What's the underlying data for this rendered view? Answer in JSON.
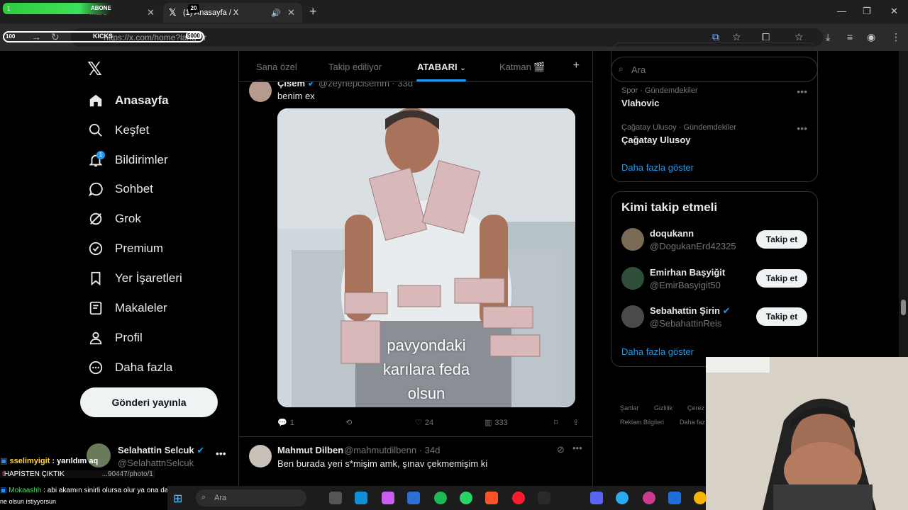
{
  "browser": {
    "tab1_title": "...ard",
    "tab2_title": "(1) Anasayfa / X",
    "url": "https://x.com/home?lang=tr",
    "overlay_abone": "ABONE",
    "overlay_abone_count": "20",
    "overlay_abone_one": "1",
    "overlay_kicks": "KICKS",
    "overlay_kicks_min": "100",
    "overlay_kicks_max": "5000"
  },
  "nav": {
    "logo": "𝕏",
    "items": [
      {
        "label": "Anasayfa",
        "icon": "home-icon",
        "active": true
      },
      {
        "label": "Keşfet",
        "icon": "search-icon"
      },
      {
        "label": "Bildirimler",
        "icon": "bell-icon",
        "badge": "1"
      },
      {
        "label": "Sohbet",
        "icon": "chat-icon"
      },
      {
        "label": "Grok",
        "icon": "grok-icon"
      },
      {
        "label": "Premium",
        "icon": "verified-icon"
      },
      {
        "label": "Yer İşaretleri",
        "icon": "bookmark-icon"
      },
      {
        "label": "Makaleler",
        "icon": "article-icon"
      },
      {
        "label": "Profil",
        "icon": "person-icon"
      },
      {
        "label": "Daha fazla",
        "icon": "more-circle-icon"
      }
    ],
    "post_button": "Gönderi yayınla",
    "account": {
      "name": "Selahattin Selcuk",
      "handle": "@SelahattnSelcuk"
    }
  },
  "timeline": {
    "tabs": [
      "Sana özel",
      "Takip ediliyor",
      "ATABARI",
      "Katman 🎬"
    ],
    "active_tab": "ATABARI",
    "tweet1": {
      "name": "Çisem",
      "handle": "@zeynepcisemm · 33d",
      "text": "benim ex",
      "caption_lines": [
        "pavyondaki",
        "karılara feda",
        "olsun"
      ],
      "replies": "1",
      "likes": "24",
      "views": "333"
    },
    "tweet2": {
      "name": "Mahmut Dilben",
      "handle": "@mahmutdilbenn · 34d",
      "text": "Ben burada yeri s*mişim amk, şınav çekmemişim ki"
    }
  },
  "sidebar": {
    "search_placeholder": "Ara",
    "trends": [
      {
        "meta": "Spor · Gündemdekiler",
        "name": "Vlahovic"
      },
      {
        "meta": "Çağatay Ulusoy · Gündemdekiler",
        "name": "Çağatay Ulusoy"
      }
    ],
    "show_more": "Daha fazla göster",
    "who_to_follow_title": "Kimi takip etmeli",
    "who_to_follow": [
      {
        "name": "doqukann",
        "handle": "@DogukanErd42325",
        "verified": false
      },
      {
        "name": "Emirhan Başyiğit",
        "handle": "@EmirBasyigit50",
        "verified": false
      },
      {
        "name": "Sebahattin Şirin",
        "handle": "@SebahattinReis",
        "verified": true
      }
    ],
    "follow_label": "Takip et",
    "footer": [
      "Şartlar",
      "Gizlilik",
      "Çerez",
      "Reklam Bilgileri",
      "Daha faz"
    ]
  },
  "stream_chat": {
    "line1_user": "sselimyigit",
    "line1_text": ": yarıldım aq",
    "line2": "HAPİSTEN ÇIKTIK",
    "line2_url": "...90447/photo/1",
    "line3_user": "Mokaashh",
    "line3_text": ": abi akamın sinirli olursa olur ya ona da bi °°°°°°° mi yapalım akam seni",
    "line4": "ne olsun istiyyorsun"
  },
  "taskbar": {
    "search_placeholder": "Ara"
  }
}
